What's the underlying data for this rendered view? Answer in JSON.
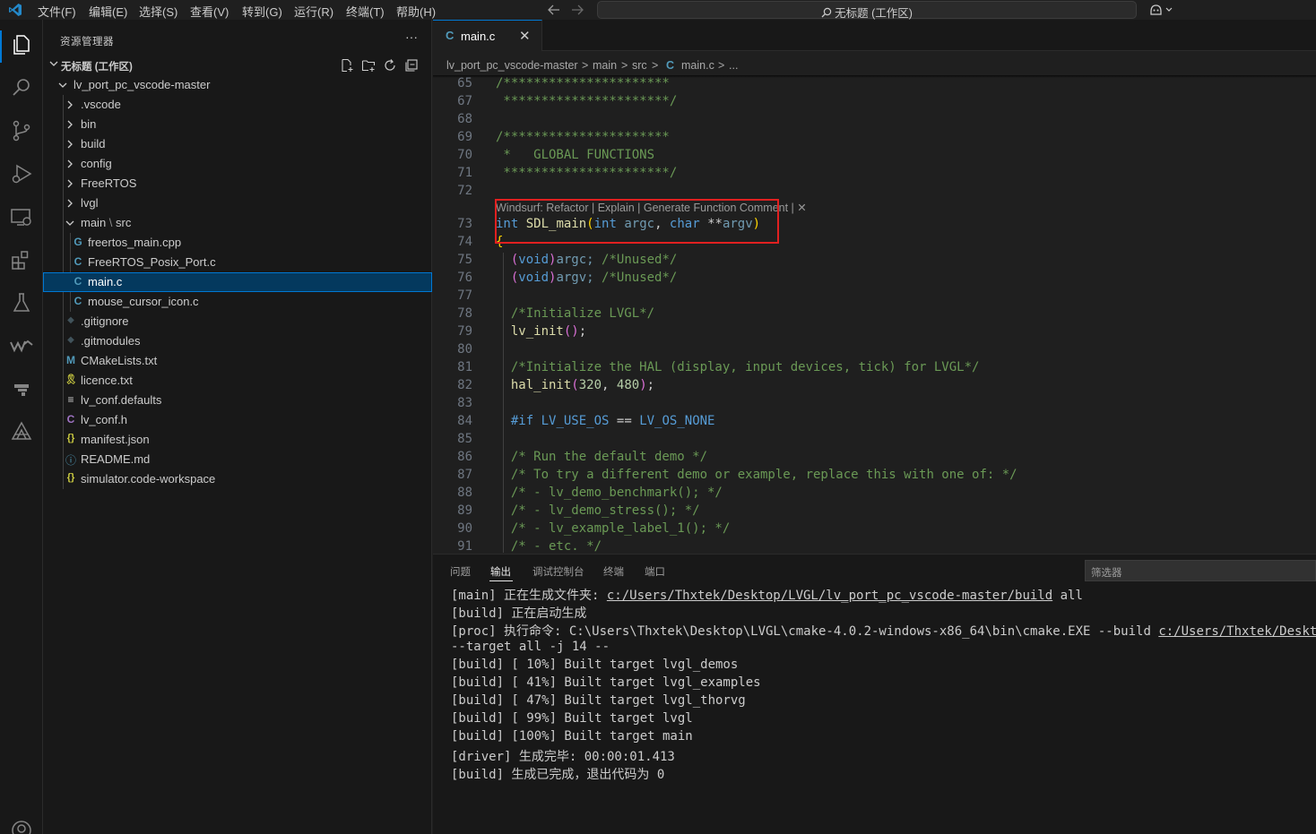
{
  "titlebar": {
    "menus": [
      "文件(F)",
      "编辑(E)",
      "选择(S)",
      "查看(V)",
      "转到(G)",
      "运行(R)",
      "终端(T)",
      "帮助(H)"
    ],
    "back_icon": "arrow-left-icon",
    "forward_icon": "arrow-right-icon",
    "command_center": "无标题 (工作区)",
    "search_icon": "search-icon",
    "copilot_icon": "copilot-icon"
  },
  "activitybar": {
    "items": [
      "explorer-icon",
      "search-icon",
      "source-control-icon",
      "run-debug-icon",
      "remote-explorer-icon",
      "extensions-icon",
      "testing-icon",
      "windsurf-icon",
      "cmake-icon",
      "platformio-icon",
      "account-icon"
    ]
  },
  "sidebar": {
    "title": "资源管理器",
    "more": "···",
    "workspace": "无标题 (工作区)",
    "tree": [
      {
        "label": "lv_port_pc_vscode-master",
        "type": "folder-open",
        "icon": ""
      },
      {
        "label": ".vscode",
        "type": "folder",
        "icon": ""
      },
      {
        "label": "bin",
        "type": "folder",
        "icon": ""
      },
      {
        "label": "build",
        "type": "folder",
        "icon": ""
      },
      {
        "label": "config",
        "type": "folder",
        "icon": ""
      },
      {
        "label": "FreeRTOS",
        "type": "folder",
        "icon": ""
      },
      {
        "label": "lvgl",
        "type": "folder",
        "icon": ""
      },
      {
        "label": "main",
        "label2": "src",
        "type": "folder-open",
        "icon": ""
      },
      {
        "label": "freertos_main.cpp",
        "type": "file",
        "icon": "G"
      },
      {
        "label": "FreeRTOS_Posix_Port.c",
        "type": "file",
        "icon": "C"
      },
      {
        "label": "main.c",
        "type": "file",
        "icon": "C",
        "selected": true
      },
      {
        "label": "mouse_cursor_icon.c",
        "type": "file",
        "icon": "C"
      },
      {
        "label": ".gitignore",
        "type": "file",
        "icon": "◆"
      },
      {
        "label": ".gitmodules",
        "type": "file",
        "icon": "◆"
      },
      {
        "label": "CMakeLists.txt",
        "type": "file",
        "icon": "M"
      },
      {
        "label": "licence.txt",
        "type": "file",
        "icon": "🎗"
      },
      {
        "label": "lv_conf.defaults",
        "type": "file",
        "icon": "≡"
      },
      {
        "label": "lv_conf.h",
        "type": "file",
        "icon": "C"
      },
      {
        "label": "manifest.json",
        "type": "file",
        "icon": "{}"
      },
      {
        "label": "README.md",
        "type": "file",
        "icon": "ⓘ"
      },
      {
        "label": "simulator.code-workspace",
        "type": "file",
        "icon": "{}"
      }
    ]
  },
  "editor": {
    "tab": {
      "icon": "C",
      "label": "main.c",
      "close": "✕"
    },
    "breadcrumb": [
      "lv_port_pc_vscode-master",
      ">",
      "main",
      ">",
      "src",
      ">",
      "C",
      "main.c",
      ">",
      "..."
    ],
    "line_numbers": [
      "65",
      "67",
      "68",
      "69",
      "70",
      "71",
      "72",
      "73",
      "74",
      "75",
      "76",
      "77",
      "78",
      "79",
      "80",
      "81",
      "82",
      "83",
      "84",
      "85",
      "86",
      "87",
      "88",
      "89",
      "90",
      "91"
    ],
    "codelens": "Windsurf: Refactor | Explain | Generate Function Comment | ✕",
    "code": {
      "l65": "/**********************",
      "l67": " **********************/",
      "l69": "/**********************",
      "l70": " *   GLOBAL FUNCTIONS",
      "l71": " **********************/",
      "l73_kw1": "int",
      "l73_fn": "SDL_main",
      "l73_kw2": "int",
      "l73_p1": "argc",
      "l73_kw3": "char",
      "l73_stars": "**",
      "l73_p2": "argv",
      "l74": "{",
      "l75_kw": "void",
      "l75_v": "argc;",
      "l75_c": "/*Unused*/",
      "l76_kw": "void",
      "l76_v": "argv;",
      "l76_c": "/*Unused*/",
      "l78": "/*Initialize LVGL*/",
      "l79_fn": "lv_init",
      "l81": "/*Initialize the HAL (display, input devices, tick) for LVGL*/",
      "l82_fn": "hal_init",
      "l82_n1": "320",
      "l82_n2": "480",
      "l84_kw": "#if",
      "l84_m1": "LV_USE_OS",
      "l84_op": "==",
      "l84_m2": "LV_OS_NONE",
      "l86": "/* Run the default demo */",
      "l87": "/* To try a different demo or example, replace this with one of: */",
      "l88": "/* - lv_demo_benchmark(); */",
      "l89": "/* - lv_demo_stress(); */",
      "l90": "/* - lv_example_label_1(); */",
      "l91": "/* - etc. */"
    }
  },
  "panel": {
    "tabs": [
      "问题",
      "输出",
      "调试控制台",
      "终端",
      "端口"
    ],
    "active_tab": "输出",
    "filter_placeholder": "筛选器",
    "output": {
      "o1_a": "[main] 正在生成文件夹: ",
      "o1_link": "c:/Users/Thxtek/Desktop/LVGL/lv_port_pc_vscode-master/build",
      "o1_b": " all",
      "o2": "[build] 正在启动生成",
      "o3_a": "[proc] 执行命令: C:\\Users\\Thxtek\\Desktop\\LVGL\\cmake-4.0.2-windows-x86_64\\bin\\cmake.EXE --build ",
      "o3_link": "c:/Users/Thxtek/Desktop",
      "o4": "--target all -j 14 --",
      "o5": "[build] [ 10%] Built target lvgl_demos",
      "o6": "[build] [ 41%] Built target lvgl_examples",
      "o7": "[build] [ 47%] Built target lvgl_thorvg",
      "o8": "[build] [ 99%] Built target lvgl",
      "o9": "[build] [100%] Built target main",
      "o10": "[driver] 生成完毕: 00:00:01.413",
      "o11": "[build] 生成已完成，退出代码为 0"
    }
  },
  "colors": {
    "accent": "#0078d4",
    "highlight_box": "#e02020",
    "comment": "#6a9955",
    "keyword": "#569cd6",
    "function": "#dcdcaa"
  }
}
